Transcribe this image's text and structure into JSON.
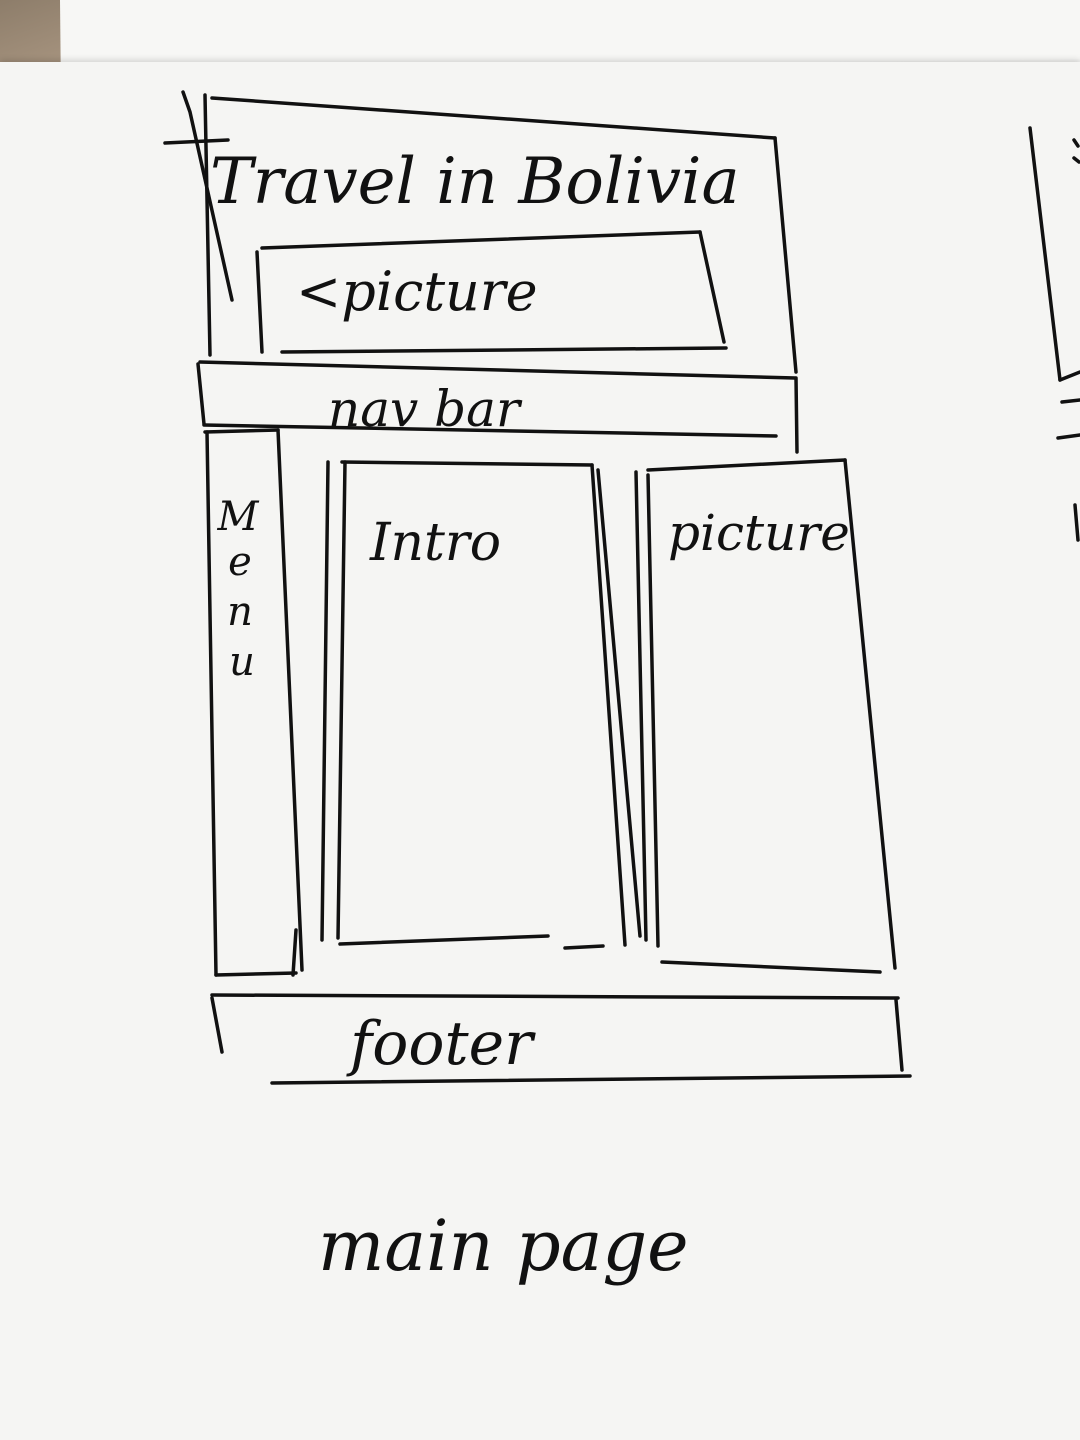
{
  "diagram": {
    "header_title": "Travel in Bolivia",
    "header_picture": "<picture",
    "nav_bar": "nav bar",
    "menu": [
      "M",
      "e",
      "n",
      "u"
    ],
    "intro": "Intro",
    "side_picture": "picture",
    "footer": "footer",
    "caption": "main page"
  },
  "ink_color": "#111111",
  "paper_color": "#f5f5f3"
}
